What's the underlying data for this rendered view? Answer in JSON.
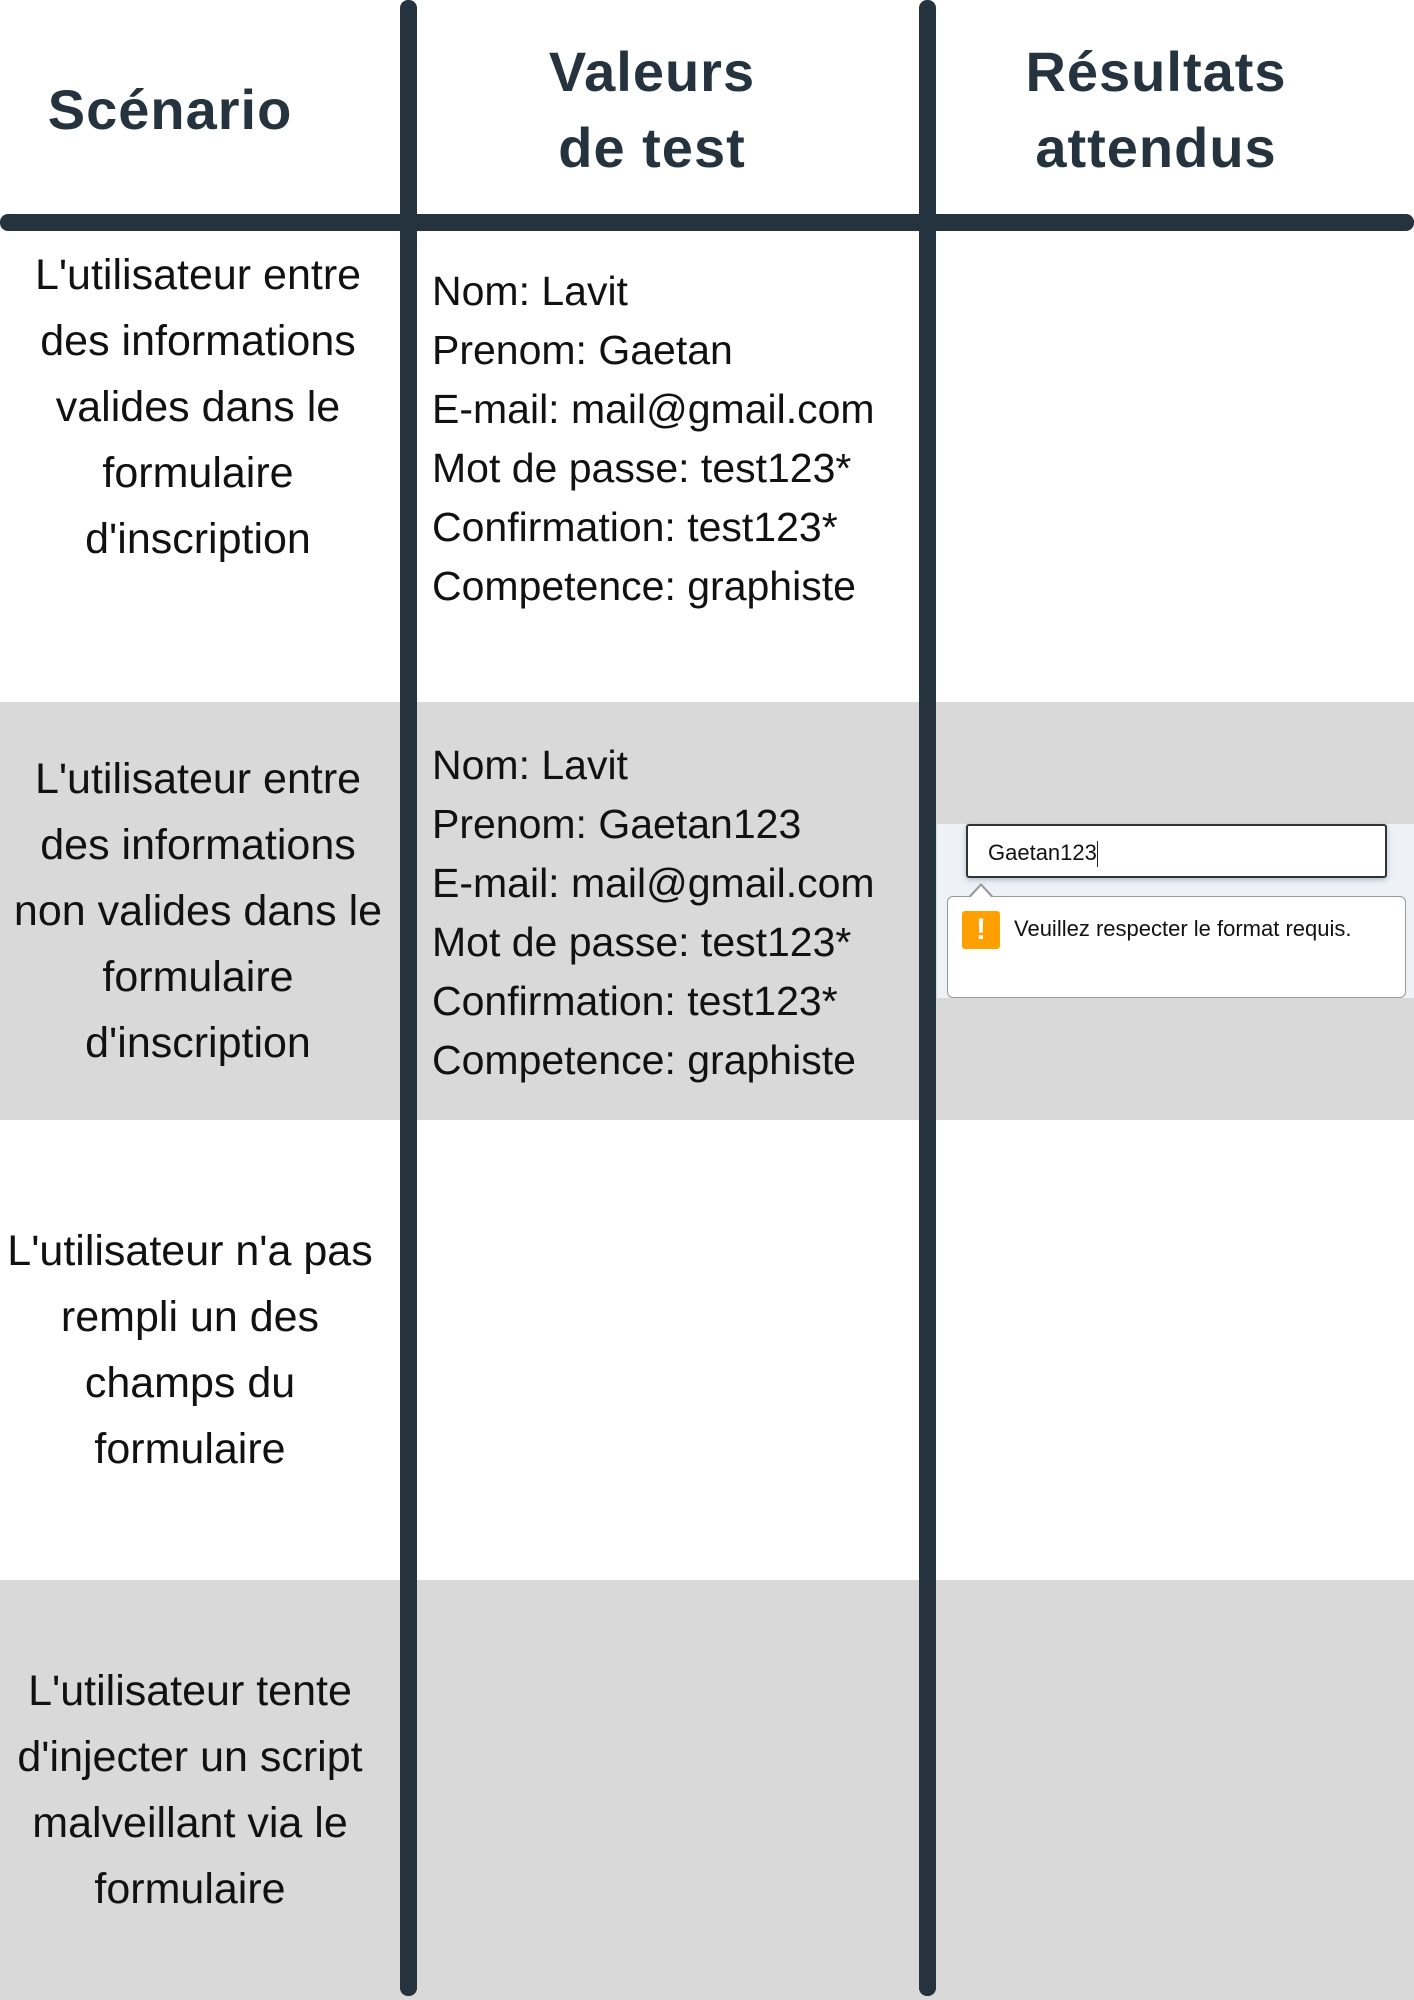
{
  "headers": {
    "scenario": "Scénario",
    "values_line1": "Valeurs",
    "values_line2": "de test",
    "results_line1": "Résultats",
    "results_line2": "attendus"
  },
  "rows": [
    {
      "scenario": "L'utilisateur entre des informations valides dans le formulaire d'inscription",
      "values": [
        "Nom: Lavit",
        "Prenom: Gaetan",
        "E-mail: mail@gmail.com",
        "Mot de passe: test123*",
        "Confirmation: test123*",
        "Competence: graphiste"
      ]
    },
    {
      "scenario": "L'utilisateur entre des informations non valides dans le formulaire d'inscription",
      "values": [
        "Nom: Lavit",
        "Prenom: Gaetan123",
        "E-mail: mail@gmail.com",
        "Mot de passe: test123*",
        "Confirmation: test123*",
        "Competence: graphiste"
      ],
      "result": {
        "input_value": "Gaetan123",
        "tooltip_message": "Veuillez respecter le format requis.",
        "icon": "warning-icon",
        "icon_glyph": "!",
        "icon_color": "#ffa000"
      }
    },
    {
      "scenario": "L'utilisateur n'a pas rempli un des champs du formulaire"
    },
    {
      "scenario": "L'utilisateur tente d'injecter un script malveillant via le formulaire"
    }
  ],
  "colors": {
    "rule": "#25333f",
    "band": "#d9d9d9"
  }
}
